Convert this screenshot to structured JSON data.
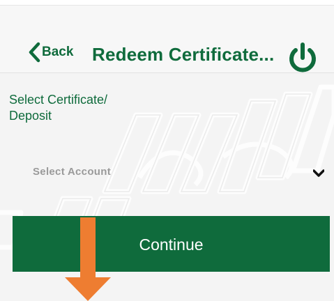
{
  "header": {
    "back_label": "Back",
    "title": "Redeem Certificate...",
    "power_icon": "power-icon"
  },
  "form": {
    "label": "Select Certificate/ Deposit",
    "select": {
      "placeholder": "Select Account",
      "chevron_icon": "chevron-down-icon"
    },
    "continue_label": "Continue"
  },
  "annotation": {
    "arrow_icon": "arrow-down-icon"
  },
  "colors": {
    "brand_green": "#0f6b3c",
    "annotation_orange": "#ee7d31",
    "placeholder_gray": "#9a9a9a",
    "header_bg": "#f7f7f7"
  }
}
